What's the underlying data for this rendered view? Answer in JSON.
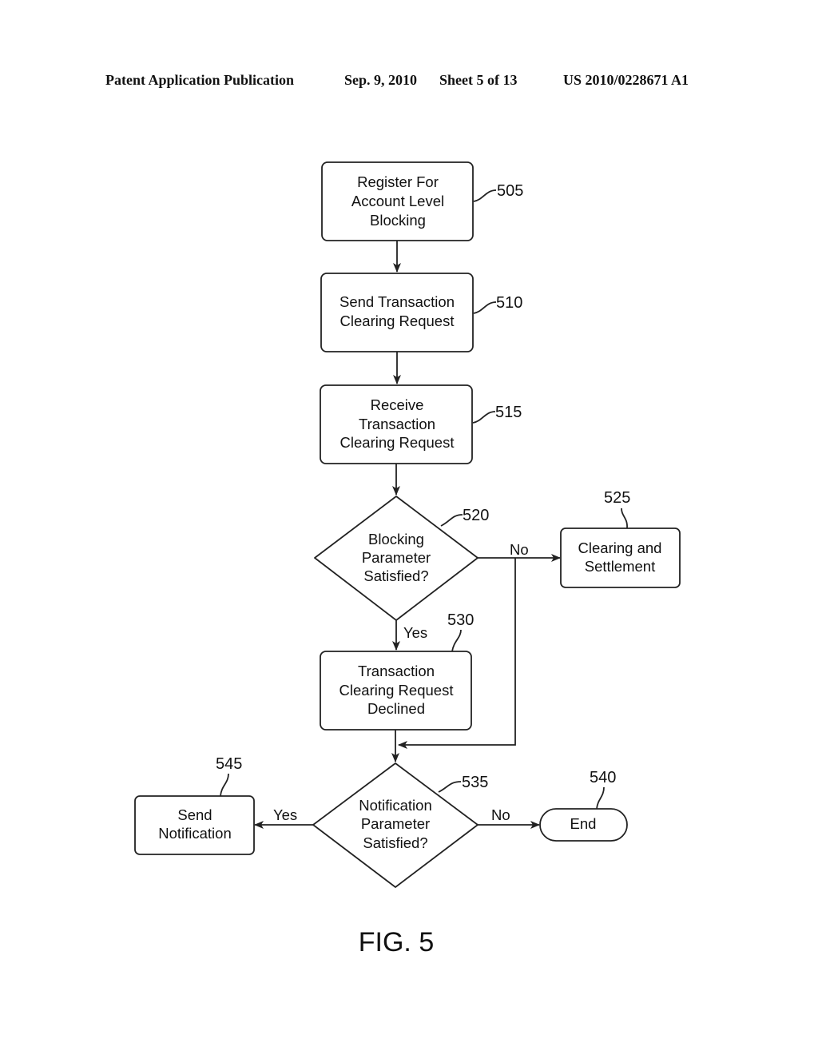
{
  "header": {
    "publication": "Patent Application Publication",
    "date": "Sep. 9, 2010",
    "sheet": "Sheet 5 of 13",
    "number": "US 2010/0228671 A1"
  },
  "figure_label": "FIG. 5",
  "nodes": {
    "n505": {
      "ref": "505",
      "lines": [
        "Register For",
        "Account Level",
        "Blocking"
      ]
    },
    "n510": {
      "ref": "510",
      "lines": [
        "Send Transaction",
        "Clearing Request"
      ]
    },
    "n515": {
      "ref": "515",
      "lines": [
        "Receive",
        "Transaction",
        "Clearing Request"
      ]
    },
    "n520": {
      "ref": "520",
      "lines": [
        "Blocking",
        "Parameter",
        "Satisfied?"
      ]
    },
    "n525": {
      "ref": "525",
      "lines": [
        "Clearing and",
        "Settlement"
      ]
    },
    "n530": {
      "ref": "530",
      "lines": [
        "Transaction",
        "Clearing Request",
        "Declined"
      ]
    },
    "n535": {
      "ref": "535",
      "lines": [
        "Notification",
        "Parameter",
        "Satisfied?"
      ]
    },
    "n540": {
      "ref": "540",
      "lines": [
        "End"
      ]
    },
    "n545": {
      "ref": "545",
      "lines": [
        "Send",
        "Notification"
      ]
    }
  },
  "edge_labels": {
    "e520_no": "No",
    "e520_yes": "Yes",
    "e535_yes": "Yes",
    "e535_no": "No"
  }
}
